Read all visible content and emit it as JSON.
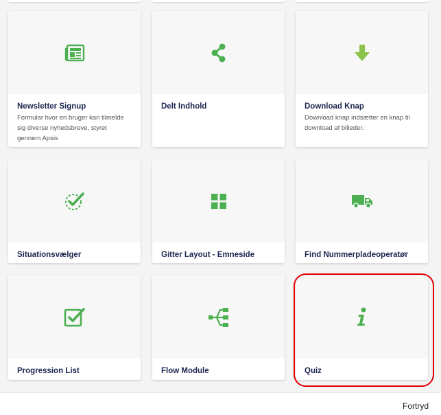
{
  "accent_color": "#4caf50",
  "highlight_color": "#e10000",
  "cards": [
    {
      "title": "Newsletter Signup",
      "description": "Formular hvor en bruger kan tilmelde sig diverse nyhedsbreve, styret gennem Apsis",
      "icon": "newspaper-icon"
    },
    {
      "title": "Delt Indhold",
      "description": "",
      "icon": "share-icon"
    },
    {
      "title": "Download Knap",
      "description": "Download knap indsætter en knap til download af billeder.",
      "icon": "download-arrow-icon"
    },
    {
      "title": "Situationsvælger",
      "description": "",
      "icon": "dashed-check-circle-icon"
    },
    {
      "title": "Gitter Layout - Emneside",
      "description": "",
      "icon": "grid-icon"
    },
    {
      "title": "Find Nummerpladeoperatør",
      "description": "",
      "icon": "truck-icon"
    },
    {
      "title": "Progression List",
      "description": "",
      "icon": "checkbox-icon"
    },
    {
      "title": "Flow Module",
      "description": "",
      "icon": "flow-tree-icon"
    },
    {
      "title": "Quiz",
      "description": "",
      "icon": "info-icon"
    }
  ],
  "footer": {
    "cancel_label": "Fortryd"
  }
}
